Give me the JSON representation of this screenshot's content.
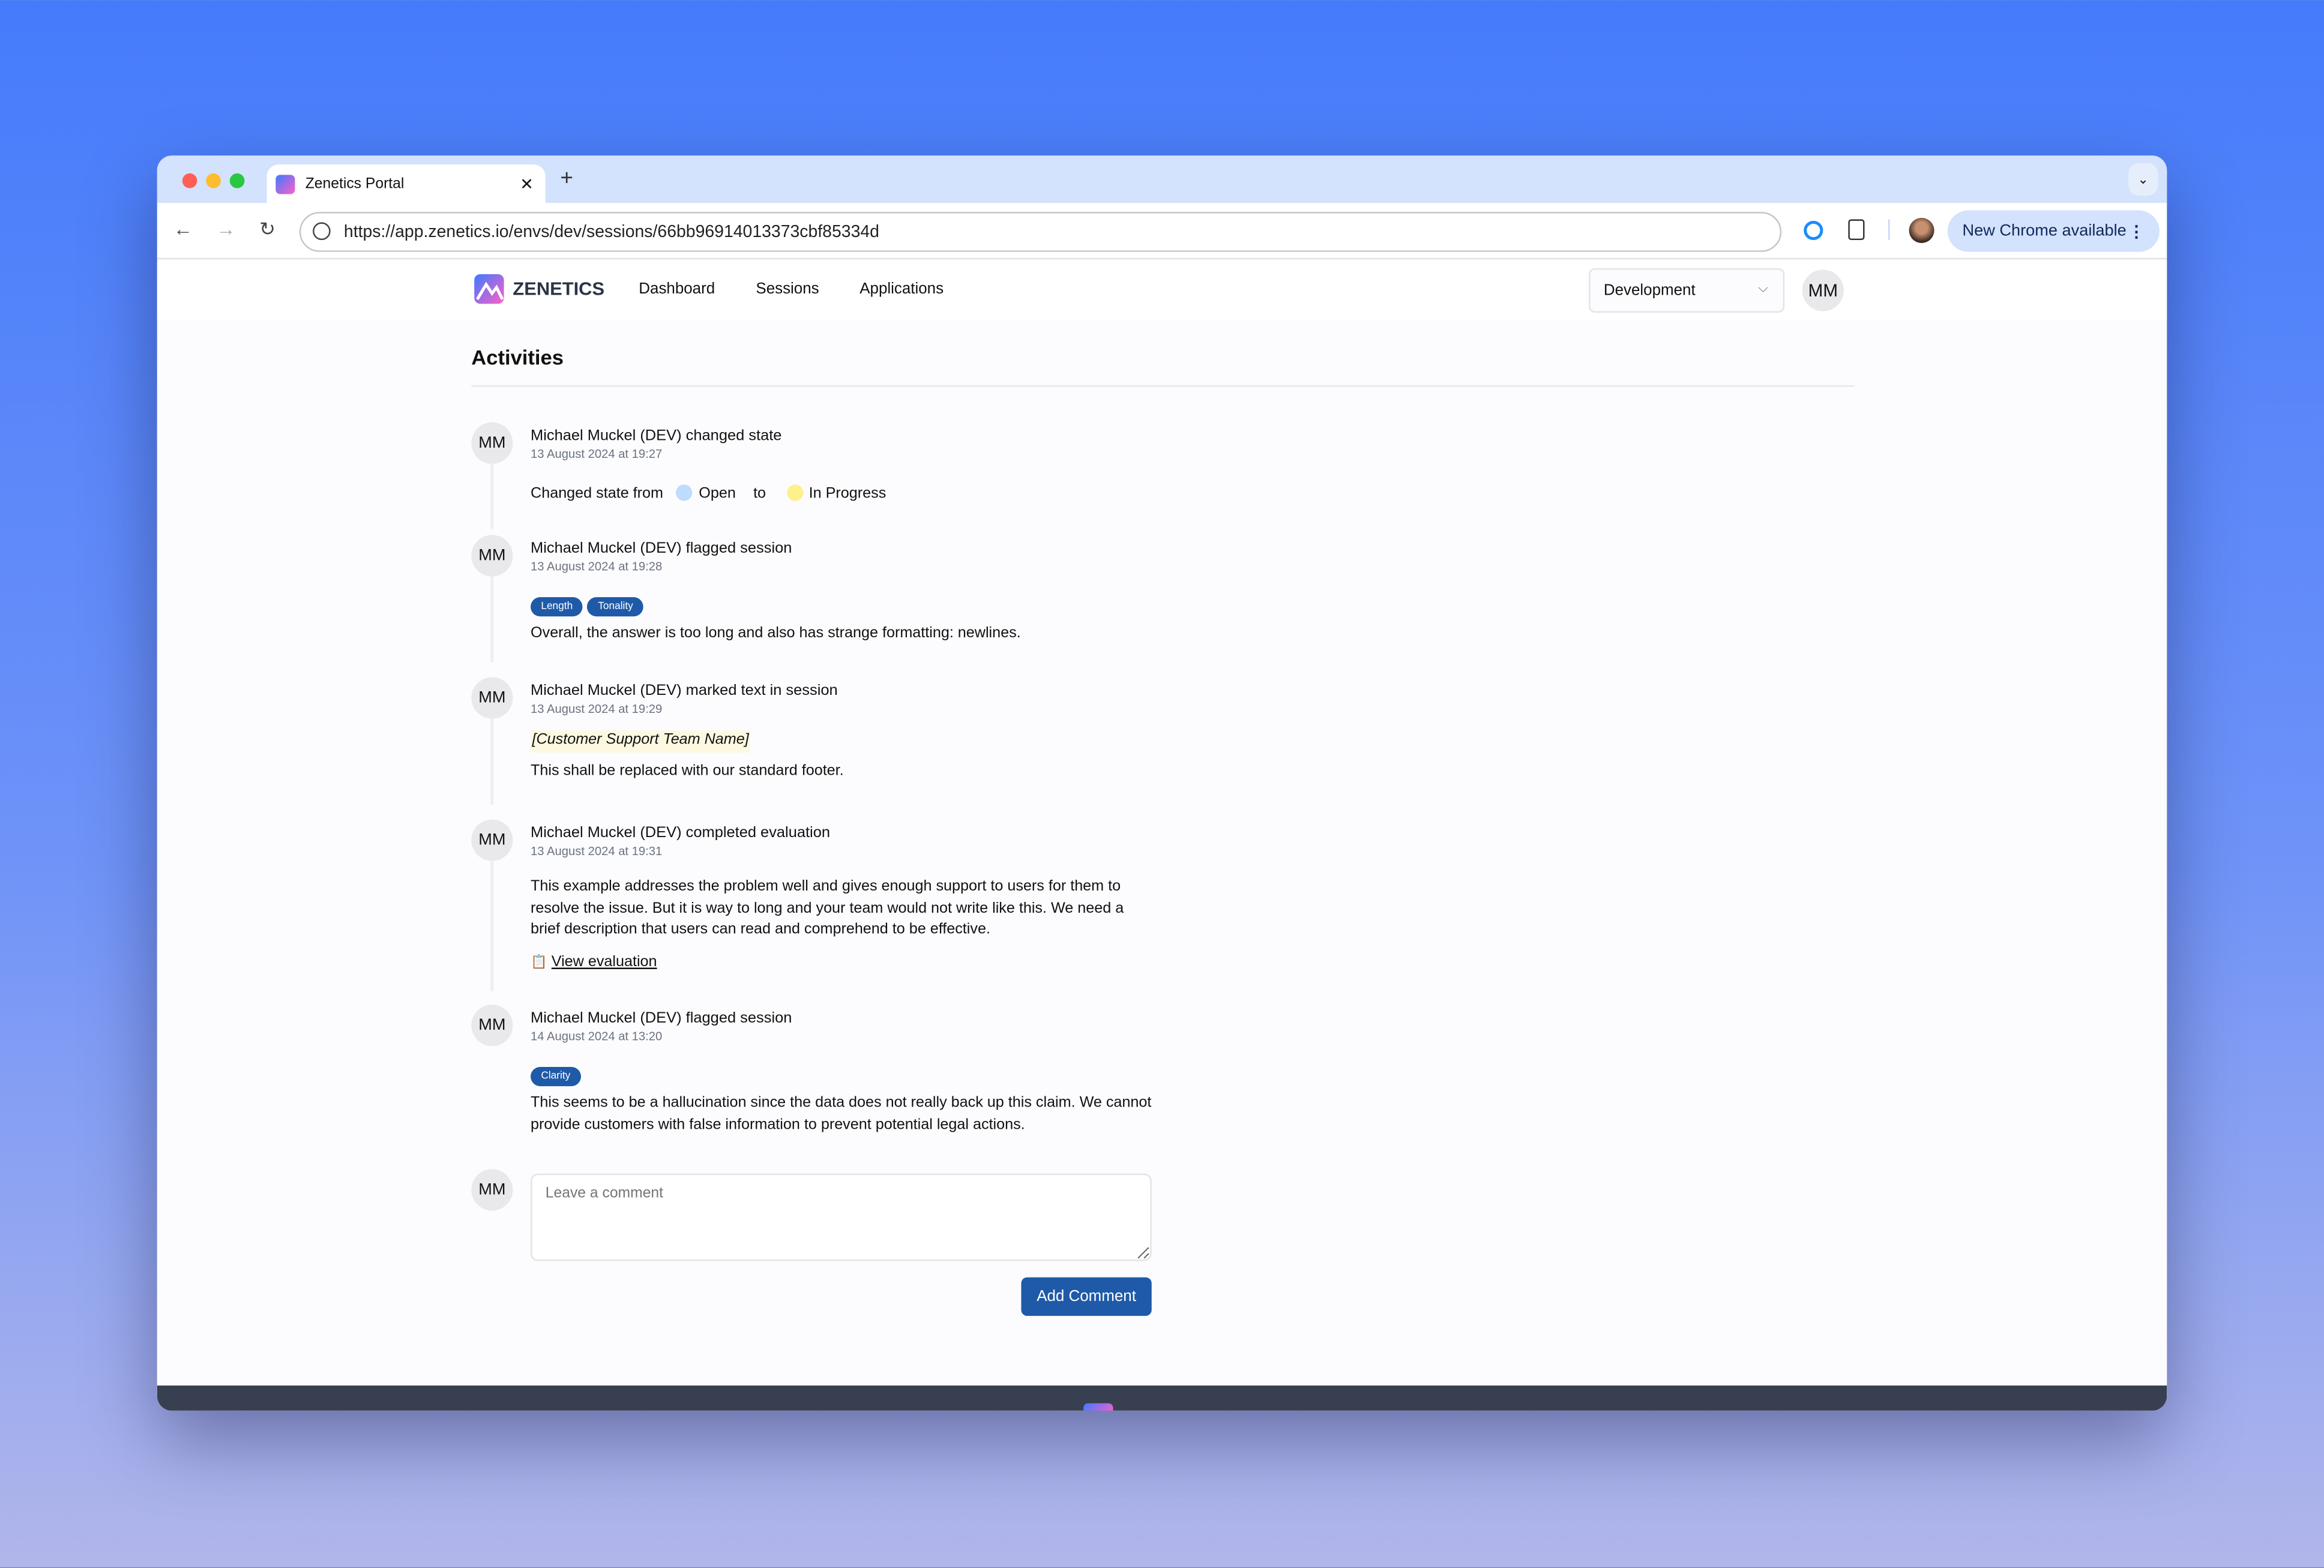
{
  "browser": {
    "tab_title": "Zenetics Portal",
    "url": "https://app.zenetics.io/envs/dev/sessions/66bb96914013373cbf85334d",
    "update_button": "New Chrome available",
    "colors": {
      "tabbar": "#d3e2fd",
      "close": "#ff5f57",
      "minimize": "#febc2e",
      "maximize": "#28c840"
    }
  },
  "header": {
    "brand": "ZENETICS",
    "nav": [
      "Dashboard",
      "Sessions",
      "Applications"
    ],
    "environment": "Development",
    "user_initials": "MM"
  },
  "main": {
    "title": "Activities",
    "activities": [
      {
        "initials": "MM",
        "author": "Michael Muckel (DEV)",
        "action": "changed state",
        "time": "13 August 2024 at 19:27",
        "state_prefix": "Changed state from",
        "from_state": "Open",
        "to_word": "to",
        "to_state": "In Progress",
        "from_color": "#bfdbfe",
        "to_color": "#fef08a"
      },
      {
        "initials": "MM",
        "author": "Michael Muckel (DEV)",
        "action": "flagged session",
        "time": "13 August 2024 at 19:28",
        "tags": [
          "Length",
          "Tonality"
        ],
        "text": "Overall, the answer is too long and also has strange formatting: newlines."
      },
      {
        "initials": "MM",
        "author": "Michael Muckel (DEV)",
        "action": "marked text in session",
        "time": "13 August 2024 at 19:29",
        "marked": "[Customer Support Team Name]",
        "text": "This shall be replaced with our standard footer."
      },
      {
        "initials": "MM",
        "author": "Michael Muckel (DEV)",
        "action": "completed evaluation",
        "time": "13 August 2024 at 19:31",
        "text": "This example addresses the problem well and gives enough support to users for them to resolve the issue. But it is way to long and your team would not write like this. We need a brief description that users can read and comprehend to be effective.",
        "link": "View evaluation"
      },
      {
        "initials": "MM",
        "author": "Michael Muckel (DEV)",
        "action": "flagged session",
        "time": "14 August 2024 at 13:20",
        "tags": [
          "Clarity"
        ],
        "text": "This seems to be a hallucination since the data does not really back up this claim. We cannot provide customers with false information to prevent potential legal actions."
      }
    ],
    "comment": {
      "initials": "MM",
      "placeholder": "Leave a comment",
      "button": "Add Comment"
    },
    "accent": "#1f5aa8"
  }
}
